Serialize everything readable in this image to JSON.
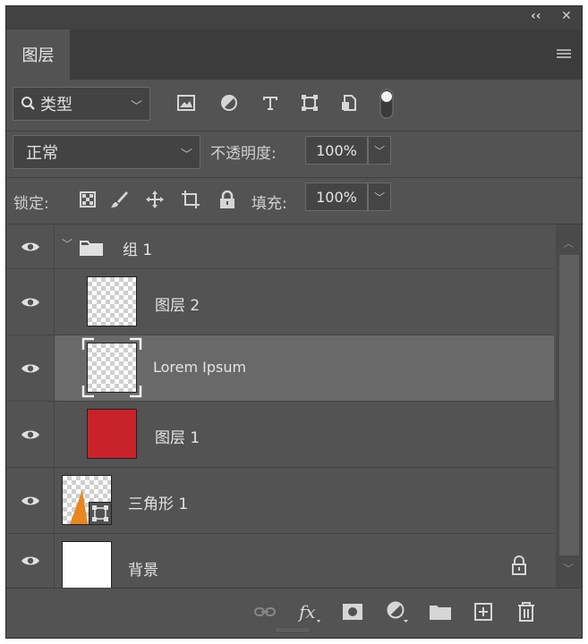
{
  "panel": {
    "tab_label": "图层",
    "filter": {
      "search_label": "类型"
    },
    "blend_mode": "正常",
    "opacity_label": "不透明度:",
    "opacity_value": "100%",
    "lock_label": "锁定:",
    "fill_label": "填充:",
    "fill_value": "100%"
  },
  "layers": [
    {
      "name": "组 1",
      "type": "group"
    },
    {
      "name": "图层 2",
      "type": "pixel"
    },
    {
      "name": "Lorem Ipsum",
      "type": "smart",
      "selected": true
    },
    {
      "name": "图层 1",
      "type": "pixel",
      "color": "#c8232a"
    },
    {
      "name": "三角形 1",
      "type": "shape",
      "color": "#e8871e"
    },
    {
      "name": "背景",
      "type": "background",
      "locked": true
    }
  ],
  "colors": {
    "panel_bg": "#535353",
    "selected_row": "#696969",
    "layer1_fill": "#c8232a",
    "triangle_fill": "#e8871e"
  }
}
